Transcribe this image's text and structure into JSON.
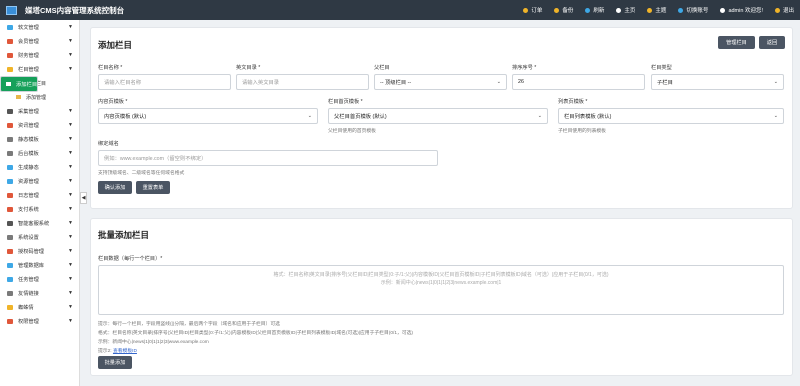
{
  "header": {
    "title": "媒塔CMS内容管理系统控制台",
    "nav": [
      {
        "label": "订单",
        "color": "#f0b429",
        "name": "order"
      },
      {
        "label": "备份",
        "color": "#f0b429",
        "name": "backup"
      },
      {
        "label": "刷新",
        "color": "#3ea8e6",
        "name": "refresh"
      },
      {
        "label": "主页",
        "color": "#ffffff",
        "name": "home"
      },
      {
        "label": "主题",
        "color": "#f0b429",
        "name": "theme"
      },
      {
        "label": "切换账号",
        "color": "#3ea8e6",
        "name": "switch-account"
      },
      {
        "label": "admin 欢迎您!",
        "color": "#ffffff",
        "name": "user"
      },
      {
        "label": "退出",
        "color": "#f0b429",
        "name": "logout"
      }
    ]
  },
  "sidebar": {
    "items_top": [
      {
        "label": "软文管理",
        "color": "#3ea8e6"
      },
      {
        "label": "会员管理",
        "color": "#e0573a"
      },
      {
        "label": "财务管理",
        "color": "#e0573a"
      },
      {
        "label": "栏目管理",
        "color": "#f0b429"
      }
    ],
    "subitems": [
      {
        "label": "添加栏目",
        "selected": true
      },
      {
        "label": "管理栏目",
        "selected": false
      },
      {
        "label": "添加管理",
        "selected": false
      }
    ],
    "items_bottom": [
      {
        "label": "采集管理",
        "color": "#555555"
      },
      {
        "label": "资讯管理",
        "color": "#e0573a"
      },
      {
        "label": "静态模板",
        "color": "#7a7a7a"
      },
      {
        "label": "后台模板",
        "color": "#7a7a7a"
      },
      {
        "label": "生成静态",
        "color": "#3ea8e6"
      },
      {
        "label": "资源管理",
        "color": "#3ea8e6"
      },
      {
        "label": "日志管理",
        "color": "#e0573a"
      },
      {
        "label": "支付系统",
        "color": "#e0573a"
      },
      {
        "label": "智能客服系统",
        "color": "#555555"
      },
      {
        "label": "系统设置",
        "color": "#7a7a7a"
      },
      {
        "label": "授权码管理",
        "color": "#e0573a"
      },
      {
        "label": "管理数据库",
        "color": "#3ea8e6"
      },
      {
        "label": "任务管理",
        "color": "#3ea8e6"
      },
      {
        "label": "友情链接",
        "color": "#7a7a7a"
      },
      {
        "label": "蜘蛛情",
        "color": "#f0b429"
      },
      {
        "label": "权限管理",
        "color": "#e0573a"
      }
    ],
    "caret": "▼",
    "collapse": "◀"
  },
  "add_form": {
    "title": "添加栏目",
    "btn_manage": "管理栏目",
    "btn_back": "返回",
    "name_label": "栏目名称 *",
    "name_placeholder": "请输入栏目名称",
    "en_label": "英文目录 *",
    "en_placeholder": "请输入英文目录",
    "parent_label": "父栏目",
    "parent_value": "-- 顶级栏目 --",
    "order_label": "排序序号 *",
    "order_value": "26",
    "type_label": "栏目类型",
    "type_value": "子栏目",
    "content_tpl_label": "内容页模板 *",
    "content_tpl_value": "内容页模板 (默认)",
    "parent_tpl_label": "栏目首页模板 *",
    "parent_tpl_value": "父栏目首页模板 (默认)",
    "parent_tpl_hint": "父栏目使用的首页模板",
    "list_tpl_label": "列表页模板 *",
    "list_tpl_value": "栏目列表模板 (默认)",
    "list_tpl_hint": "子栏目使用的列表模板",
    "domain_label": "绑定域名",
    "domain_placeholder": "例如：www.example.com（留空则不绑定）",
    "domain_hint": "支持顶级域名、二级域名等任何域名格式",
    "btn_submit": "确认添加",
    "btn_reset": "重置表单"
  },
  "batch_form": {
    "title": "批量添加栏目",
    "data_label": "栏目数据（每行一个栏目）*",
    "textarea_placeholder": "格式：栏目名称|英文目录|排序号|父栏目ID|栏目类型(0:子/1:父)|内容模板ID|父栏目首页模板ID|子栏目列表模板ID|域名（可选）|应用于子栏目(0/1，可选)\n示例：新闻中心|news|1|0|1|1|2|3|news.example.com|1",
    "hint1": "提示：每行一个栏目，字段用竖线(|)分隔，最后两个字段（域名和应用于子栏目）可选",
    "hint2": "格式：栏目名称|英文目录|排序号|父栏目ID|栏目类型(0:子/1:父)|内容模板ID|父栏目首页模板ID|子栏目列表模板ID|域名(可选)|应用于子栏目(0/1，可选)",
    "hint3": "示例：新闻中心|news|1|0|1|1|2|3|www.example.com",
    "hint4_prefix": "提示2:",
    "hint4_link": "查看模板ID",
    "btn_batch": "批量添加"
  }
}
